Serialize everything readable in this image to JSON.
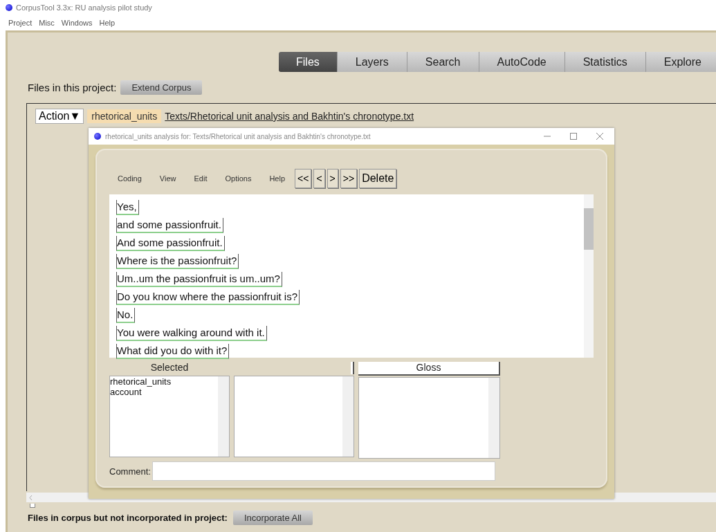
{
  "window": {
    "title": "CorpusTool 3.3x: RU analysis pilot study"
  },
  "menu": [
    "Project",
    "Misc",
    "Windows",
    "Help"
  ],
  "tabs": [
    {
      "label": "Files",
      "selected": true
    },
    {
      "label": "Layers",
      "selected": false
    },
    {
      "label": "Search",
      "selected": false
    },
    {
      "label": "AutoCode",
      "selected": false
    },
    {
      "label": "Statistics",
      "selected": false
    },
    {
      "label": "Explore",
      "selected": false
    }
  ],
  "files_label": "Files in this project:",
  "extend_button": "Extend Corpus",
  "file_row": {
    "action": "Action▼",
    "layer": "rhetorical_units",
    "path": "Texts/Rhetorical unit analysis and Bakhtin's chronotype.txt"
  },
  "dialog": {
    "title": "rhetorical_units analysis for: Texts/Rhetorical unit analysis and Bakhtin's chronotype.txt",
    "menu": [
      "Coding",
      "View",
      "Edit",
      "Options",
      "Help"
    ],
    "nav_buttons": [
      "<<",
      "<",
      ">",
      ">>",
      "Delete"
    ],
    "segments": [
      "Yes,",
      "and some passionfruit.",
      "And some passionfruit.",
      "Where is the passionfruit?",
      "Um..um the passionfruit is um..um?",
      "Do you know where the passionfruit is?",
      "No.",
      "You were walking around with it.",
      "What did you do with it?"
    ],
    "selected_header": "Selected",
    "gloss_header": "Gloss",
    "selected_items": [
      "rhetorical_units",
      "account"
    ],
    "comment_label": "Comment:"
  },
  "bottom_label": "Files in corpus but not incorporated in project:",
  "incorporate_button": "Incorporate All"
}
